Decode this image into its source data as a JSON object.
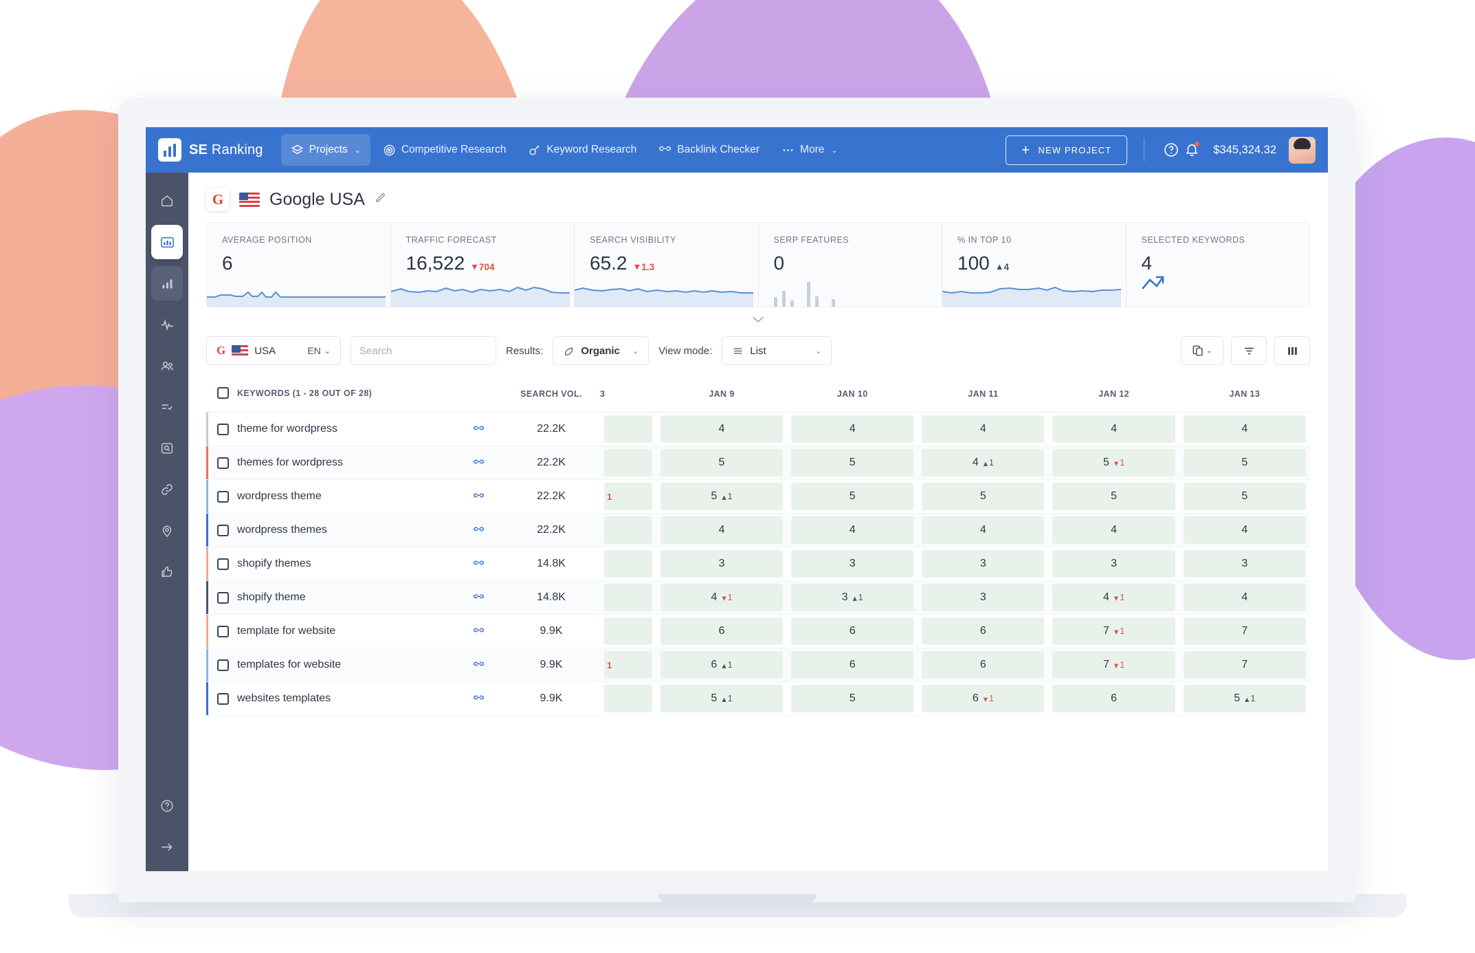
{
  "topbar": {
    "brand_bold": "SE",
    "brand_rest": " Ranking",
    "nav": [
      {
        "label": "Projects",
        "icon": "layers-icon",
        "active": true,
        "caret": "⌄"
      },
      {
        "label": "Competitive Research",
        "icon": "target-icon",
        "active": false
      },
      {
        "label": "Keyword Research",
        "icon": "key-icon",
        "active": false
      },
      {
        "label": "Backlink Checker",
        "icon": "link-chain-icon",
        "active": false
      },
      {
        "label": "More",
        "icon": "ellipsis-icon",
        "active": false,
        "caret": "⌄"
      }
    ],
    "new_project_label": "NEW PROJECT",
    "balance": "$345,324.32",
    "help_icon": "question-circle-icon",
    "bell_icon": "bell-icon",
    "avatar_icon": "user-avatar"
  },
  "sidebar": {
    "items": [
      {
        "name": "home",
        "icon": "home-icon",
        "state": ""
      },
      {
        "name": "dashboard",
        "icon": "dashboard-chart-icon",
        "state": "active"
      },
      {
        "name": "rankings",
        "icon": "bar-chart-icon",
        "state": "current"
      },
      {
        "name": "analytics",
        "icon": "pulse-icon",
        "state": ""
      },
      {
        "name": "competitors",
        "icon": "people-icon",
        "state": ""
      },
      {
        "name": "audit",
        "icon": "checklist-icon",
        "state": ""
      },
      {
        "name": "site-audit",
        "icon": "magnifier-box-icon",
        "state": ""
      },
      {
        "name": "backlinks",
        "icon": "link-icon",
        "state": ""
      },
      {
        "name": "local-marketing",
        "icon": "pin-icon",
        "state": ""
      },
      {
        "name": "social",
        "icon": "thumbs-up-icon",
        "state": ""
      }
    ],
    "bottom": [
      {
        "name": "help",
        "icon": "question-circle-icon"
      },
      {
        "name": "expand",
        "icon": "arrow-right-icon"
      }
    ]
  },
  "project": {
    "engine_badge": "G",
    "flag": "us-flag",
    "title": "Google USA",
    "edit_icon": "pencil-icon"
  },
  "metrics": [
    {
      "label": "AVERAGE POSITION",
      "value": "6",
      "delta": "",
      "delta_dir": "",
      "viz": "sparkline"
    },
    {
      "label": "TRAFFIC FORECAST",
      "value": "16,522",
      "delta": "704",
      "delta_dir": "down",
      "viz": "sparkline"
    },
    {
      "label": "SEARCH VISIBILITY",
      "value": "65.2",
      "delta": "1.3",
      "delta_dir": "down",
      "viz": "sparkline"
    },
    {
      "label": "SERP FEATURES",
      "value": "0",
      "delta": "",
      "delta_dir": "",
      "viz": "bars"
    },
    {
      "label": "% IN TOP 10",
      "value": "100",
      "delta": "4",
      "delta_dir": "up",
      "viz": "sparkline"
    },
    {
      "label": "SELECTED KEYWORDS",
      "value": "4",
      "delta": "",
      "delta_dir": "",
      "viz": "keyword-icon"
    }
  ],
  "collapse_icon": "chevron-down-icon",
  "toolbar": {
    "geo_engine": "G",
    "geo_country": "USA",
    "geo_lang": "EN",
    "search_placeholder": "Search",
    "search_value": "",
    "search_icon": "search-icon",
    "results_label": "Results:",
    "results_value": "Organic",
    "results_icon": "leaf-icon",
    "viewmode_label": "View mode:",
    "viewmode_value": "List",
    "viewmode_icon": "list-icon",
    "actions": [
      {
        "name": "device-toggle-button",
        "icon": "devices-icon",
        "caret": true
      },
      {
        "name": "filter-button",
        "icon": "filter-icon",
        "caret": false
      },
      {
        "name": "columns-button",
        "icon": "columns-icon",
        "caret": false
      }
    ]
  },
  "table": {
    "headers": {
      "keywords": "KEYWORDS (1 - 28 OUT OF 28)",
      "search_vol": "SEARCH VOL.",
      "partial": "3",
      "dates": [
        "JAN 9",
        "JAN 10",
        "JAN 11",
        "JAN 12",
        "JAN 13"
      ]
    },
    "rows": [
      {
        "keyword": "theme for wordpress",
        "vol": "22.2K",
        "accent": "#c6cad6",
        "partial": "",
        "ranks": [
          {
            "v": "4"
          },
          {
            "v": "4"
          },
          {
            "v": "4"
          },
          {
            "v": "4"
          },
          {
            "v": "4"
          }
        ]
      },
      {
        "keyword": "themes for wordpress",
        "vol": "22.2K",
        "accent": "#e8705f",
        "partial": "",
        "ranks": [
          {
            "v": "5"
          },
          {
            "v": "5"
          },
          {
            "v": "4",
            "c": "1",
            "d": "up"
          },
          {
            "v": "5",
            "c": "1",
            "d": "down"
          },
          {
            "v": "5"
          }
        ]
      },
      {
        "keyword": "wordpress theme",
        "vol": "22.2K",
        "accent": "#8fb4e3",
        "partial": "1",
        "ranks": [
          {
            "v": "5",
            "c": "1",
            "d": "up"
          },
          {
            "v": "5"
          },
          {
            "v": "5"
          },
          {
            "v": "5"
          },
          {
            "v": "5"
          }
        ]
      },
      {
        "keyword": "wordpress themes",
        "vol": "22.2K",
        "accent": "#3a6fd0",
        "partial": "",
        "ranks": [
          {
            "v": "4"
          },
          {
            "v": "4"
          },
          {
            "v": "4"
          },
          {
            "v": "4"
          },
          {
            "v": "4"
          }
        ]
      },
      {
        "keyword": "shopify themes",
        "vol": "14.8K",
        "accent": "#f0a98e",
        "partial": "",
        "ranks": [
          {
            "v": "3"
          },
          {
            "v": "3"
          },
          {
            "v": "3"
          },
          {
            "v": "3"
          },
          {
            "v": "3"
          }
        ]
      },
      {
        "keyword": "shopify theme",
        "vol": "14.8K",
        "accent": "#4a5266",
        "partial": "",
        "ranks": [
          {
            "v": "4",
            "c": "1",
            "d": "down"
          },
          {
            "v": "3",
            "c": "1",
            "d": "up"
          },
          {
            "v": "3"
          },
          {
            "v": "4",
            "c": "1",
            "d": "down"
          },
          {
            "v": "4"
          }
        ]
      },
      {
        "keyword": "template for website",
        "vol": "9.9K",
        "accent": "#f0a98e",
        "partial": "",
        "ranks": [
          {
            "v": "6"
          },
          {
            "v": "6"
          },
          {
            "v": "6"
          },
          {
            "v": "7",
            "c": "1",
            "d": "down"
          },
          {
            "v": "7"
          }
        ]
      },
      {
        "keyword": "templates for website",
        "vol": "9.9K",
        "accent": "#8fb4e3",
        "partial": "1",
        "ranks": [
          {
            "v": "6",
            "c": "1",
            "d": "up"
          },
          {
            "v": "6"
          },
          {
            "v": "6"
          },
          {
            "v": "7",
            "c": "1",
            "d": "down"
          },
          {
            "v": "7"
          }
        ]
      },
      {
        "keyword": "websites templates",
        "vol": "9.9K",
        "accent": "#3a6fd0",
        "partial": "",
        "ranks": [
          {
            "v": "5",
            "c": "1",
            "d": "up"
          },
          {
            "v": "5"
          },
          {
            "v": "6",
            "c": "1",
            "d": "down"
          },
          {
            "v": "6"
          },
          {
            "v": "5",
            "c": "1",
            "d": "up"
          }
        ]
      }
    ]
  },
  "colors": {
    "brand_blue": "#3873cf",
    "sidebar": "#4b5369",
    "rank_bg": "#e9f2ea",
    "down": "#d8544a",
    "peach": "#f3ab93",
    "purple": "#cba4e8"
  }
}
